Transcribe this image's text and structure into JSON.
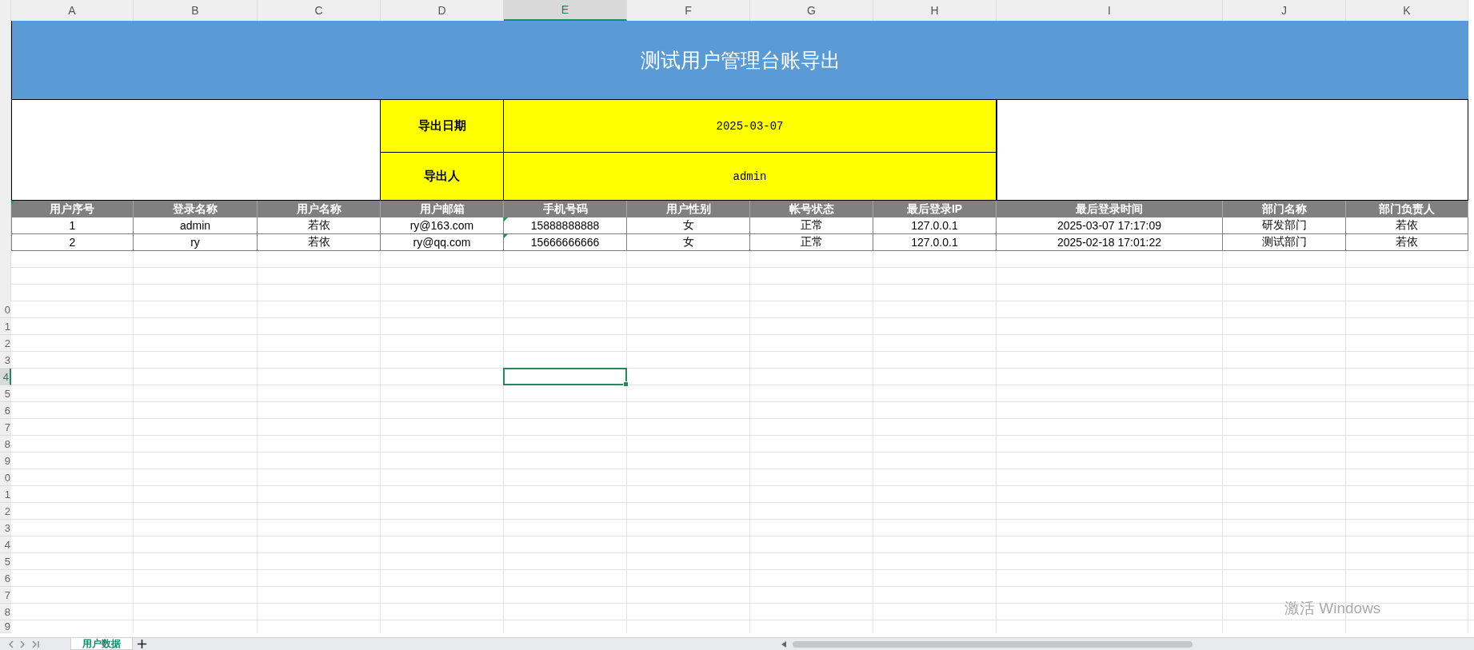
{
  "column_headers": [
    {
      "label": "A",
      "selected": false
    },
    {
      "label": "B",
      "selected": false
    },
    {
      "label": "C",
      "selected": false
    },
    {
      "label": "D",
      "selected": false
    },
    {
      "label": "E",
      "selected": true
    },
    {
      "label": "F",
      "selected": false
    },
    {
      "label": "G",
      "selected": false
    },
    {
      "label": "H",
      "selected": false
    },
    {
      "label": "I",
      "selected": false
    },
    {
      "label": "J",
      "selected": false
    },
    {
      "label": "K",
      "selected": false
    }
  ],
  "row_headers": [
    {
      "label": "0",
      "selected": false
    },
    {
      "label": "1",
      "selected": false
    },
    {
      "label": "2",
      "selected": false
    },
    {
      "label": "3",
      "selected": false
    },
    {
      "label": "4",
      "selected": true
    },
    {
      "label": "5",
      "selected": false
    },
    {
      "label": "6",
      "selected": false
    },
    {
      "label": "7",
      "selected": false
    },
    {
      "label": "8",
      "selected": false
    },
    {
      "label": "9",
      "selected": false
    },
    {
      "label": "0",
      "selected": false
    },
    {
      "label": "1",
      "selected": false
    },
    {
      "label": "2",
      "selected": false
    },
    {
      "label": "3",
      "selected": false
    },
    {
      "label": "4",
      "selected": false
    },
    {
      "label": "5",
      "selected": false
    },
    {
      "label": "6",
      "selected": false
    },
    {
      "label": "7",
      "selected": false
    },
    {
      "label": "8",
      "selected": false
    },
    {
      "label": "9",
      "selected": false
    }
  ],
  "title": "测试用户管理台账导出",
  "export_info": [
    {
      "label": "导出日期",
      "value": "2025-03-07"
    },
    {
      "label": "导出人",
      "value": "admin"
    }
  ],
  "table": {
    "columns": [
      {
        "label": "用户序号",
        "flagged": true
      },
      {
        "label": "登录名称",
        "flagged": false
      },
      {
        "label": "用户名称",
        "flagged": false
      },
      {
        "label": "用户邮箱",
        "flagged": false
      },
      {
        "label": "手机号码",
        "flagged": false
      },
      {
        "label": "用户性别",
        "flagged": false
      },
      {
        "label": "帐号状态",
        "flagged": false
      },
      {
        "label": "最后登录IP",
        "flagged": false
      },
      {
        "label": "最后登录时间",
        "flagged": false
      },
      {
        "label": "部门名称",
        "flagged": false
      },
      {
        "label": "部门负责人",
        "flagged": false
      }
    ],
    "rows": [
      [
        {
          "text": "1",
          "flagged": false
        },
        {
          "text": "admin",
          "flagged": false
        },
        {
          "text": "若依",
          "flagged": false
        },
        {
          "text": "ry@163.com",
          "flagged": false
        },
        {
          "text": "15888888888",
          "flagged": true
        },
        {
          "text": "女",
          "flagged": false
        },
        {
          "text": "正常",
          "flagged": false
        },
        {
          "text": "127.0.0.1",
          "flagged": false
        },
        {
          "text": "2025-03-07 17:17:09",
          "flagged": false
        },
        {
          "text": "研发部门",
          "flagged": false
        },
        {
          "text": "若依",
          "flagged": false
        }
      ],
      [
        {
          "text": "2",
          "flagged": false
        },
        {
          "text": "ry",
          "flagged": false
        },
        {
          "text": "若依",
          "flagged": false
        },
        {
          "text": "ry@qq.com",
          "flagged": false
        },
        {
          "text": "15666666666",
          "flagged": true
        },
        {
          "text": "女",
          "flagged": false
        },
        {
          "text": "正常",
          "flagged": false
        },
        {
          "text": "127.0.0.1",
          "flagged": false
        },
        {
          "text": "2025-02-18 17:01:22",
          "flagged": false
        },
        {
          "text": "测试部门",
          "flagged": false
        },
        {
          "text": "若依",
          "flagged": false
        }
      ]
    ]
  },
  "sheet_tabs": [
    {
      "label": "用户数据",
      "selected": true
    }
  ],
  "os_notice": "激活 Windows"
}
